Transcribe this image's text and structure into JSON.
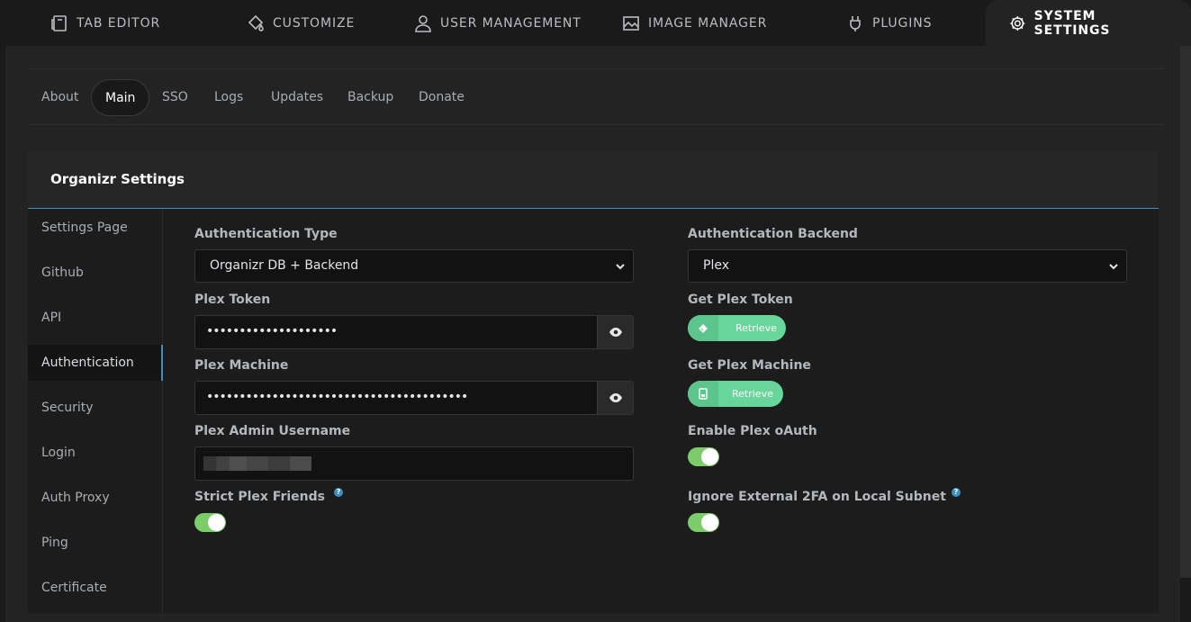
{
  "top_tabs": [
    {
      "label": "TAB EDITOR",
      "icon": "tab-icon"
    },
    {
      "label": "CUSTOMIZE",
      "icon": "paint-bucket-icon"
    },
    {
      "label": "USER MANAGEMENT",
      "icon": "user-icon"
    },
    {
      "label": "IMAGE MANAGER",
      "icon": "image-icon"
    },
    {
      "label": "PLUGINS",
      "icon": "plug-icon"
    },
    {
      "label": "SYSTEM SETTINGS",
      "icon": "gear-icon"
    }
  ],
  "sub_tabs": [
    "About",
    "Main",
    "SSO",
    "Logs",
    "Updates",
    "Backup",
    "Donate"
  ],
  "card": {
    "title": "Organizr Settings"
  },
  "side_menu": [
    "Settings Page",
    "Github",
    "API",
    "Authentication",
    "Security",
    "Login",
    "Auth Proxy",
    "Ping",
    "Certificate"
  ],
  "form": {
    "auth_type_label": "Authentication Type",
    "auth_type_value": "Organizr DB + Backend",
    "auth_backend_label": "Authentication Backend",
    "auth_backend_value": "Plex",
    "plex_token_label": "Plex Token",
    "plex_token_value": "••••••••••••••••••••",
    "get_plex_token_label": "Get Plex Token",
    "retrieve_label": "Retrieve",
    "plex_machine_label": "Plex Machine",
    "plex_machine_value": "••••••••••••••••••••••••••••••••••••••••",
    "get_plex_machine_label": "Get Plex Machine",
    "plex_admin_label": "Plex Admin Username",
    "enable_oauth_label": "Enable Plex oAuth",
    "strict_friends_label": "Strict Plex Friends",
    "ignore_2fa_label": "Ignore External 2FA on Local Subnet",
    "help_mark": "?"
  },
  "toggles": {
    "enable_plex_oauth": true,
    "strict_plex_friends": true,
    "ignore_external_2fa": true
  },
  "colors": {
    "accent_blue": "#3f8ec2",
    "retrieve_green": "#68d69a",
    "toggle_green": "#7ccc6a"
  }
}
